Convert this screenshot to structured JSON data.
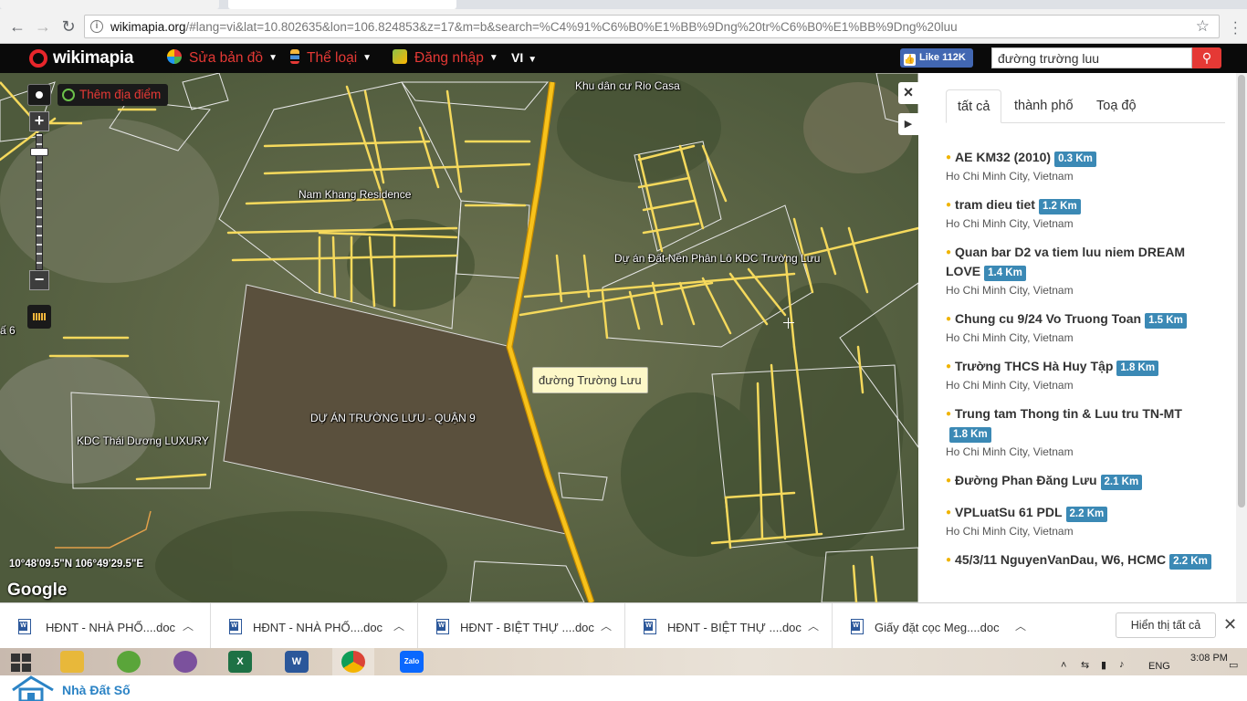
{
  "browser": {
    "url_host": "wikimapia.org",
    "url_rest": "/#lang=vi&lat=10.802635&lon=106.824853&z=17&m=b&search=%C4%91%C6%B0%E1%BB%9Dng%20tr%C6%B0%E1%BB%9Dng%20luu"
  },
  "header": {
    "logo": "wikimapia",
    "menu": [
      {
        "label": "Sửa bản đồ"
      },
      {
        "label": "Thể loại"
      },
      {
        "label": "Đăng nhập"
      }
    ],
    "language": "VI",
    "fb_like": "Like 112K",
    "search_value": "đường trường luu"
  },
  "map": {
    "add_place": "Thêm địa điểm",
    "tooltip": "đường Trường Lưu",
    "coords": "10°48'09.5\"N 106°49'29.5\"E",
    "attribution": "Google",
    "labels": [
      {
        "text": "Khu dân cư Rio Casa"
      },
      {
        "text": "Nam Khang Residence"
      },
      {
        "text": "Dự án Đất Nền Phân Lô KDC Trường Lưu"
      },
      {
        "text": "DỰ ÁN TRƯỜNG LƯU - QUẬN 9"
      },
      {
        "text": "KDC Thái Dương LUXURY"
      },
      {
        "text": "ấ 6"
      }
    ]
  },
  "panel": {
    "tabs": [
      {
        "label": "tất cả"
      },
      {
        "label": "thành phố"
      },
      {
        "label": "Toạ độ"
      }
    ],
    "results": [
      {
        "title": "AE KM32 (2010)",
        "distance": "0.3 Km",
        "place": "Ho Chi Minh City, Vietnam"
      },
      {
        "title": "tram dieu tiet",
        "distance": "1.2 Km",
        "place": "Ho Chi Minh City, Vietnam"
      },
      {
        "title": "Quan bar D2 va tiem luu niem DREAM LOVE",
        "distance": "1.4 Km",
        "place": "Ho Chi Minh City, Vietnam"
      },
      {
        "title": "Chung cu 9/24 Vo Truong Toan",
        "distance": "1.5 Km",
        "place": "Ho Chi Minh City, Vietnam"
      },
      {
        "title": "Trường THCS Hà Huy Tập",
        "distance": "1.8 Km",
        "place": "Ho Chi Minh City, Vietnam"
      },
      {
        "title": "Trung tam Thong tin & Luu tru TN-MT",
        "distance": "1.8 Km",
        "place": "Ho Chi Minh City, Vietnam"
      },
      {
        "title": "Đường Phan Đăng Lưu",
        "distance": "2.1 Km",
        "place": ""
      },
      {
        "title": "VPLuatSu 61 PDL",
        "distance": "2.2 Km",
        "place": "Ho Chi Minh City, Vietnam"
      },
      {
        "title": "45/3/11 NguyenVanDau, W6, HCMC",
        "distance": "2.2 Km",
        "place": ""
      }
    ]
  },
  "downloads": {
    "items": [
      {
        "name": "HĐNT - NHÀ PHỐ....doc"
      },
      {
        "name": "HĐNT - NHÀ PHỐ....doc"
      },
      {
        "name": "HĐNT - BIỆT THỰ ....doc"
      },
      {
        "name": "HĐNT - BIỆT THỰ ....doc"
      },
      {
        "name": "Giấy đặt cọc Meg....doc"
      }
    ],
    "show_all": "Hiển thị tất cả"
  },
  "taskbar": {
    "apps": [
      {
        "name": "file-explorer",
        "color": "#e8b83a"
      },
      {
        "name": "coccoc",
        "color": "#5aa53a"
      },
      {
        "name": "viber",
        "color": "#7b519d"
      },
      {
        "name": "excel",
        "color": "#1e7145"
      },
      {
        "name": "word",
        "color": "#2b579a"
      },
      {
        "name": "chrome",
        "color": "#db4437"
      },
      {
        "name": "zalo",
        "color": "#0a68fe"
      }
    ],
    "lang": "ENG",
    "time": "3:08 PM"
  },
  "watermark": {
    "brand": "Nhà Đất Số"
  },
  "colors": {
    "accent_red": "#e53935",
    "road_yellow": "#f5d95c",
    "distance_badge": "#3b89b5"
  }
}
